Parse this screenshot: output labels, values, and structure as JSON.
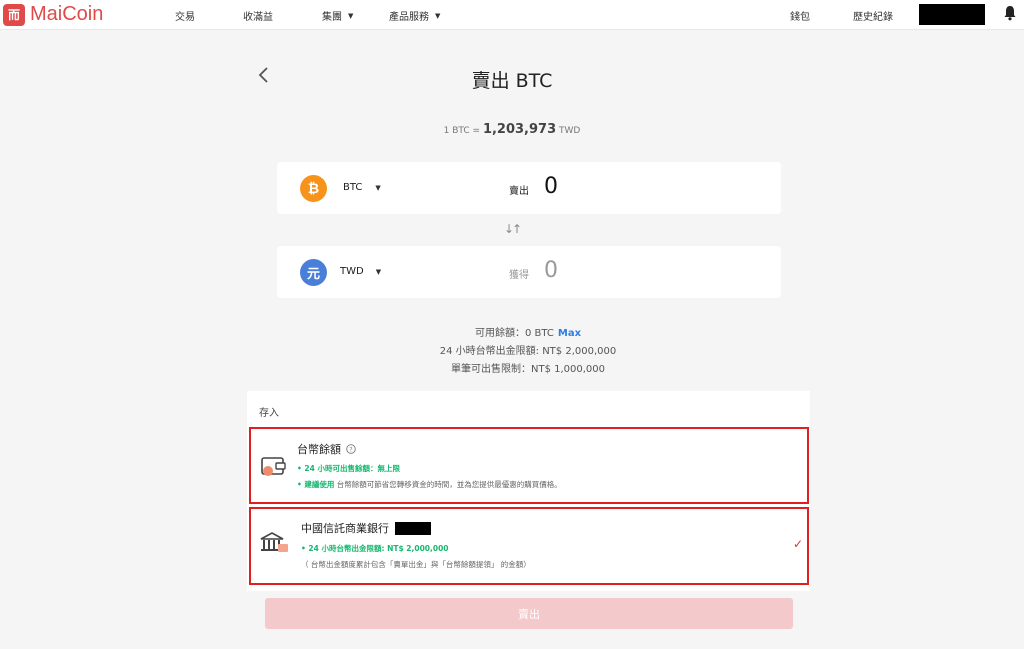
{
  "brand": {
    "logo_mark": "而",
    "name": "MaiCoin"
  },
  "nav": {
    "trade": "交易",
    "earn": "收滿益",
    "group": "集團",
    "products": "產品服務",
    "wallet": "錢包",
    "history": "歷史紀錄"
  },
  "page": {
    "title": "賣出 BTC"
  },
  "rate": {
    "prefix": "1 BTC =",
    "value": "1,203,973",
    "unit": "TWD"
  },
  "sell_card": {
    "icon_glyph": "₿",
    "currency": "BTC",
    "label": "賣出",
    "amount": "0"
  },
  "swap_glyph": "↓↑",
  "receive_card": {
    "icon_glyph": "元",
    "currency": "TWD",
    "label": "獲得",
    "amount": "0"
  },
  "info": {
    "available": "可用餘額：0 BTC",
    "max_label": "Max",
    "limit_24h": "24 小時台幣出金限額: NT$ 2,000,000",
    "single_limit": "單筆可出售限制：NT$ 1,000,000"
  },
  "deposit": {
    "heading": "存入",
    "balance_option": {
      "title": "台幣餘額",
      "line1": "• 24 小時可出售餘額：無上限",
      "line2_highlight": "• 建議使用",
      "line2_rest": "台幣餘額可節省您轉移資金的時間，並為您提供最優惠的購買價格。"
    },
    "bank_option": {
      "title": "中國信託商業銀行",
      "line1": "• 24 小時台幣出金限額: NT$ 2,000,000",
      "line2": "（ 台幣出金額度累計包含「賣單出金」與「台幣餘額提領」 的金額）",
      "check_glyph": "✓"
    }
  },
  "sell_button": "賣出",
  "colors": {
    "brand": "#e04a4a",
    "accent": "#14b86e",
    "link": "#2f7de1",
    "highlight_border": "#e02020",
    "button_disabled": "#f4c9cb"
  }
}
